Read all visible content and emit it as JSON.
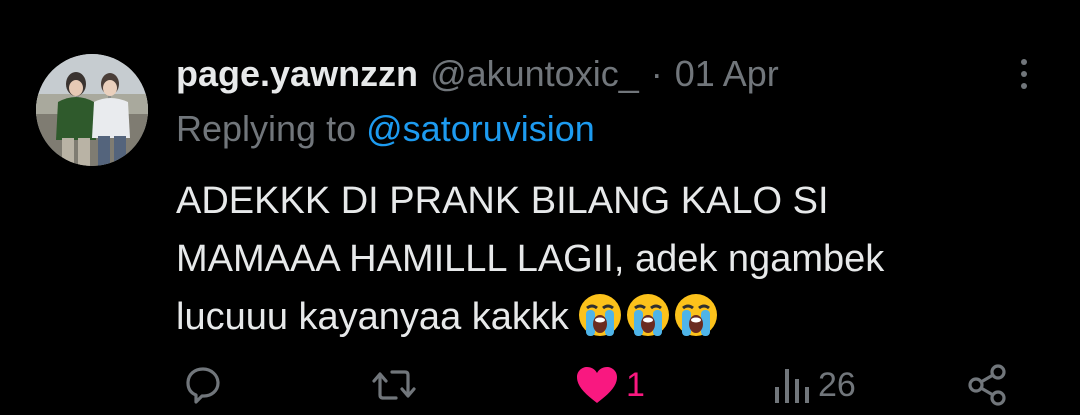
{
  "tweet": {
    "display_name": "page.yawnzzn",
    "handle": "@akuntoxic_",
    "separator": "·",
    "date": "01 Apr",
    "replying_prefix": "Replying to",
    "replying_to": "@satoruvision",
    "body_lines": [
      "ADEKKK DI PRANK BILANG KALO SI",
      "MAMAAA HAMILLL LAGII, adek ngambek",
      "lucuuu kayanyaa kakkk"
    ],
    "emojis": [
      "loudly-crying-face",
      "loudly-crying-face",
      "loudly-crying-face"
    ]
  },
  "actions": {
    "reply_icon": "reply-icon",
    "retweet_icon": "retweet-icon",
    "like_icon": "heart-icon",
    "like_count": "1",
    "views_icon": "views-icon",
    "views_count": "26",
    "share_icon": "share-icon"
  },
  "colors": {
    "background": "#000000",
    "text": "#e7e9ea",
    "muted": "#71767b",
    "mention": "#1d9bf0",
    "like": "#f91880"
  }
}
